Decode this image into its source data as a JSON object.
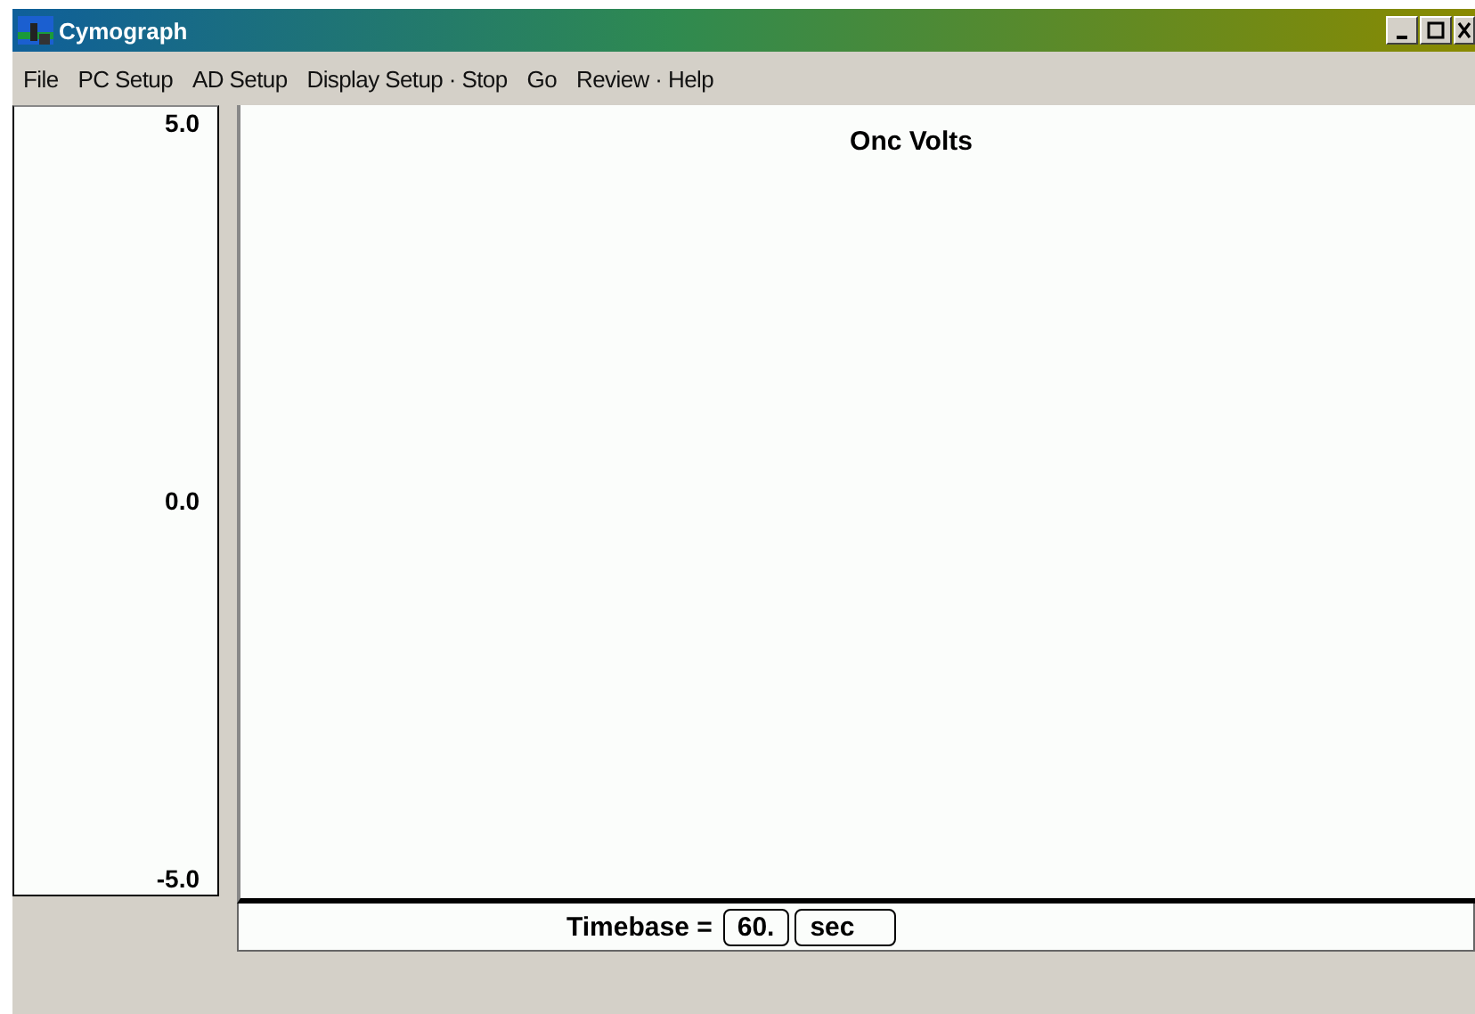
{
  "window": {
    "title": "Cymograph"
  },
  "menu": [
    "File",
    "PC Setup",
    "AD Setup",
    "Display Setup · Stop",
    "Go",
    "Review · Help"
  ],
  "axis": {
    "labels": [
      "5.0",
      "0.0",
      "-5.0"
    ]
  },
  "plot": {
    "title": "Onc Volts"
  },
  "timebase": {
    "label": "Timebase =",
    "value": "60.",
    "unit": "sec"
  }
}
